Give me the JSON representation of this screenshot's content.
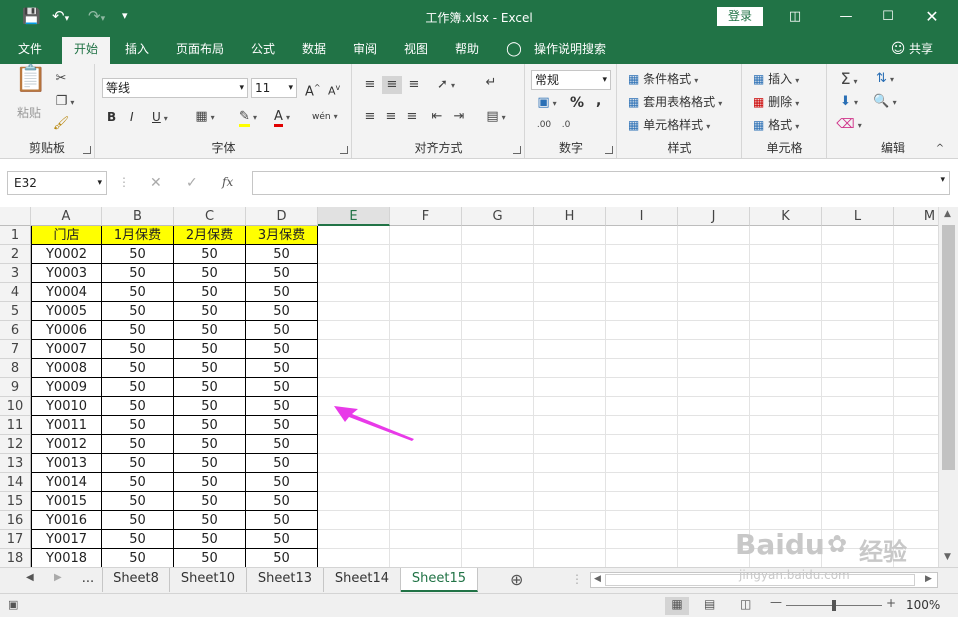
{
  "titlebar": {
    "title": "工作簿.xlsx  -  Excel",
    "login": "登录"
  },
  "tabs": [
    "文件",
    "开始",
    "插入",
    "页面布局",
    "公式",
    "数据",
    "审阅",
    "视图",
    "帮助",
    "操作说明搜索"
  ],
  "active_tab": "开始",
  "ribbon": {
    "clipboard": {
      "paste": "粘贴",
      "label": "剪贴板"
    },
    "font": {
      "name": "等线",
      "size": "11",
      "label": "字体",
      "bold": "B",
      "italic": "I",
      "underline": "U",
      "grow": "A",
      "shrink": "A",
      "wen": "wén",
      "font_color": "A"
    },
    "align": {
      "label": "对齐方式"
    },
    "number": {
      "format": "常规",
      "label": "数字",
      "percent": "%",
      "comma": ","
    },
    "styles": {
      "cond": "条件格式",
      "table": "套用表格格式",
      "cell": "单元格样式",
      "label": "样式"
    },
    "cells": {
      "insert": "插入",
      "delete": "删除",
      "format": "格式",
      "label": "单元格"
    },
    "editing": {
      "label": "编辑"
    }
  },
  "formula": {
    "namebox": "E32",
    "fx": "fx",
    "value": ""
  },
  "columns": [
    "A",
    "B",
    "C",
    "D",
    "E",
    "F",
    "G",
    "H",
    "I",
    "J",
    "K",
    "L",
    "M"
  ],
  "selected_column": "E",
  "table": {
    "headers": [
      "门店",
      "1月保费",
      "2月保费",
      "3月保费"
    ],
    "rows": [
      [
        "Y0002",
        "50",
        "50",
        "50"
      ],
      [
        "Y0003",
        "50",
        "50",
        "50"
      ],
      [
        "Y0004",
        "50",
        "50",
        "50"
      ],
      [
        "Y0005",
        "50",
        "50",
        "50"
      ],
      [
        "Y0006",
        "50",
        "50",
        "50"
      ],
      [
        "Y0007",
        "50",
        "50",
        "50"
      ],
      [
        "Y0008",
        "50",
        "50",
        "50"
      ],
      [
        "Y0009",
        "50",
        "50",
        "50"
      ],
      [
        "Y0010",
        "50",
        "50",
        "50"
      ],
      [
        "Y0011",
        "50",
        "50",
        "50"
      ],
      [
        "Y0012",
        "50",
        "50",
        "50"
      ],
      [
        "Y0013",
        "50",
        "50",
        "50"
      ],
      [
        "Y0014",
        "50",
        "50",
        "50"
      ],
      [
        "Y0015",
        "50",
        "50",
        "50"
      ],
      [
        "Y0016",
        "50",
        "50",
        "50"
      ],
      [
        "Y0017",
        "50",
        "50",
        "50"
      ],
      [
        "Y0018",
        "50",
        "50",
        "50"
      ]
    ]
  },
  "sheets": [
    "...",
    "Sheet8",
    "Sheet10",
    "Sheet13",
    "Sheet14",
    "Sheet15"
  ],
  "active_sheet": "Sheet15",
  "status": {
    "zoom": "100%"
  },
  "colors": {
    "accent": "#217346",
    "header_fill": "#ffff00",
    "arrow": "#e83ae8"
  },
  "watermark": {
    "brand": "Baidu",
    "text": "经验",
    "url": "jingyan.baidu.com"
  }
}
